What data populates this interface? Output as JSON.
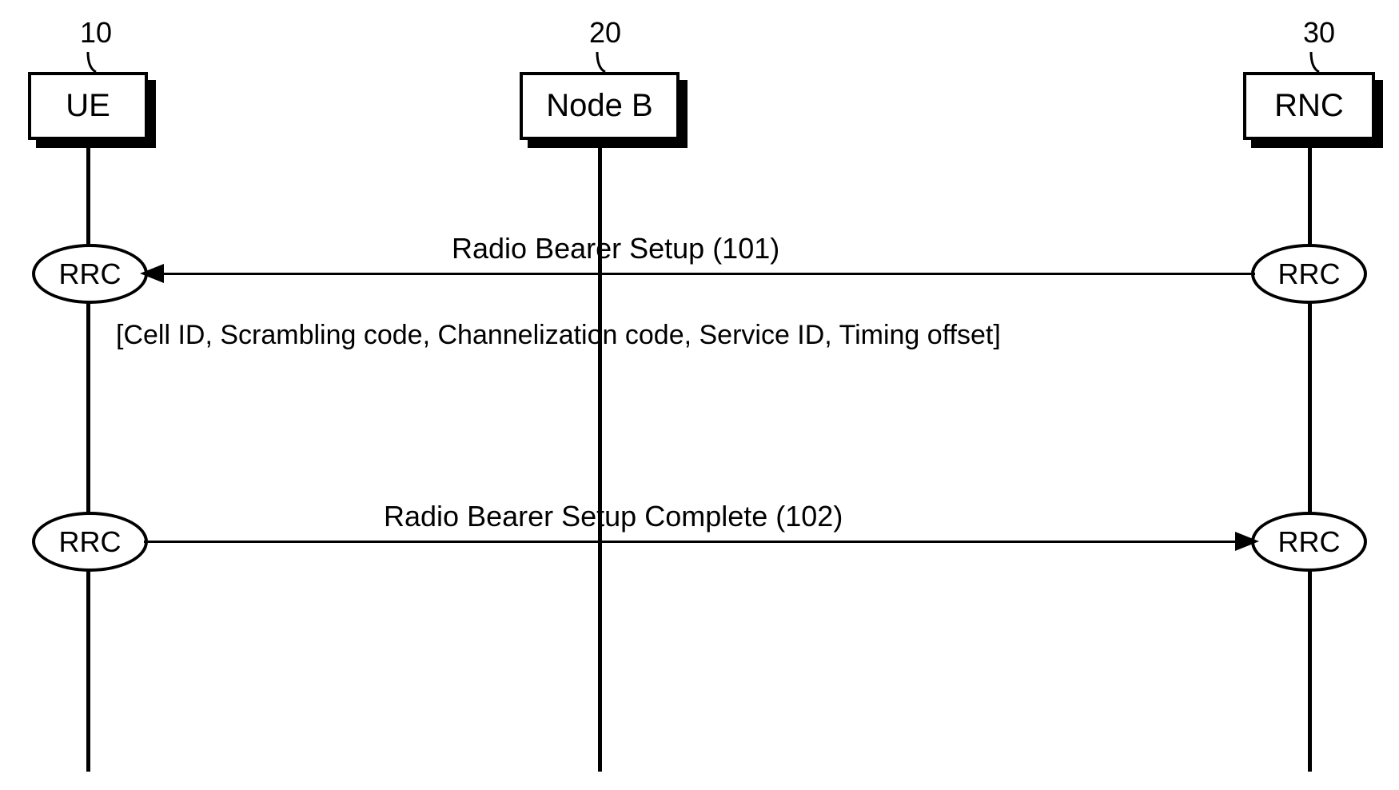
{
  "participants": {
    "ue": {
      "number": "10",
      "label": "UE"
    },
    "nodeb": {
      "number": "20",
      "label": "Node B"
    },
    "rnc": {
      "number": "30",
      "label": "RNC"
    }
  },
  "protocol_label": "RRC",
  "messages": {
    "setup": {
      "label": "Radio Bearer Setup (101)",
      "details": "[Cell ID, Scrambling code, Channelization code, Service ID, Timing offset]"
    },
    "complete": {
      "label": "Radio Bearer Setup Complete (102)"
    }
  }
}
